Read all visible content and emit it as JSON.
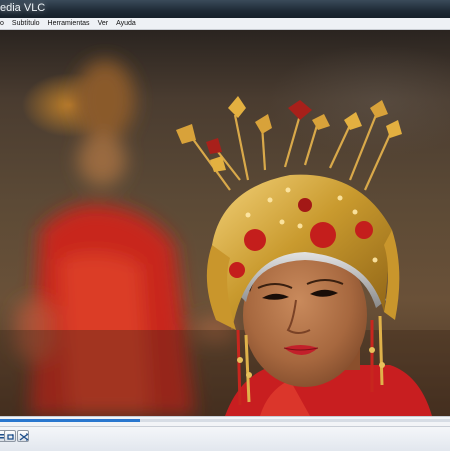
{
  "window": {
    "title": "edia VLC"
  },
  "menu": {
    "items": [
      {
        "label": "o"
      },
      {
        "label": "Subtítulo"
      },
      {
        "label": "Herramientas"
      },
      {
        "label": "Ver"
      },
      {
        "label": "Ayuda"
      }
    ]
  },
  "video": {
    "description_icon": "video-frame"
  },
  "playback": {
    "progress_fraction": 0.31,
    "accent": "#2a78cf"
  },
  "controls": {
    "buttons": [
      {
        "icon": "playlist-icon"
      },
      {
        "icon": "loop-icon"
      },
      {
        "icon": "shuffle-icon"
      }
    ]
  }
}
